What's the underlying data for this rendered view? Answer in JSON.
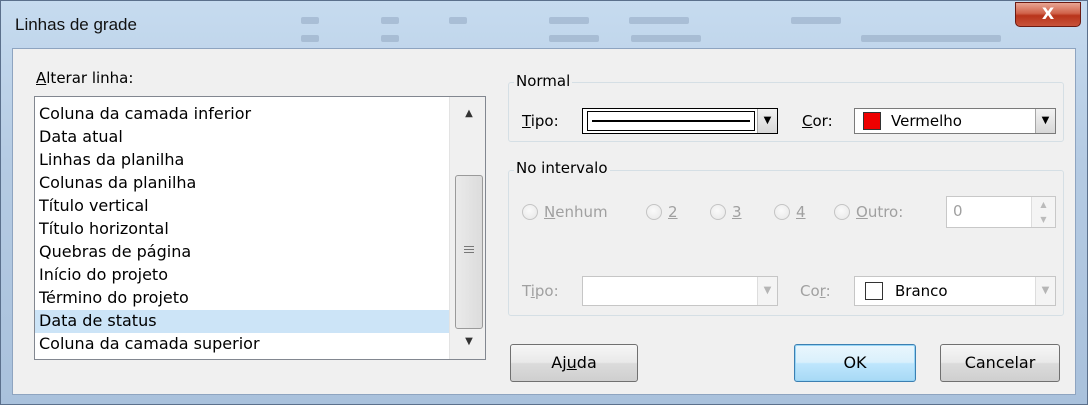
{
  "window": {
    "title": "Linhas de grade",
    "close_label": "X"
  },
  "change_line": {
    "label_prefix": "A",
    "label_rest": "lterar linha:",
    "items": [
      "Coluna da camada inferior",
      "Data atual",
      "Linhas da planilha",
      "Colunas da planilha",
      "Título vertical",
      "Título horizontal",
      "Quebras de página",
      "Início do projeto",
      "Término do projeto",
      "Data de status",
      "Coluna da camada superior"
    ],
    "selected_item": "Data de status"
  },
  "normal": {
    "group_label": "Normal",
    "type_label_key": "T",
    "type_label_rest": "ipo:",
    "color_label_key": "C",
    "color_label_rest": "or:",
    "color_value": "Vermelho",
    "color_hex": "#ee0000"
  },
  "interval": {
    "group_label": "No intervalo",
    "options": [
      {
        "key": "N",
        "rest": "enhum"
      },
      {
        "key": "2",
        "rest": ""
      },
      {
        "key": "3",
        "rest": ""
      },
      {
        "key": "4",
        "rest": ""
      },
      {
        "key": "O",
        "rest": "utro:"
      }
    ],
    "other_value": "0",
    "type_label_pre": "T",
    "type_label_key": "i",
    "type_label_rest": "po:",
    "color_label_pre": "Co",
    "color_label_key": "r",
    "color_label_rest": ":",
    "color_value": "Branco",
    "color_hex": "#ffffff"
  },
  "buttons": {
    "help_pre": "Aj",
    "help_key": "u",
    "help_rest": "da",
    "ok": "OK",
    "cancel": "Cancelar"
  }
}
